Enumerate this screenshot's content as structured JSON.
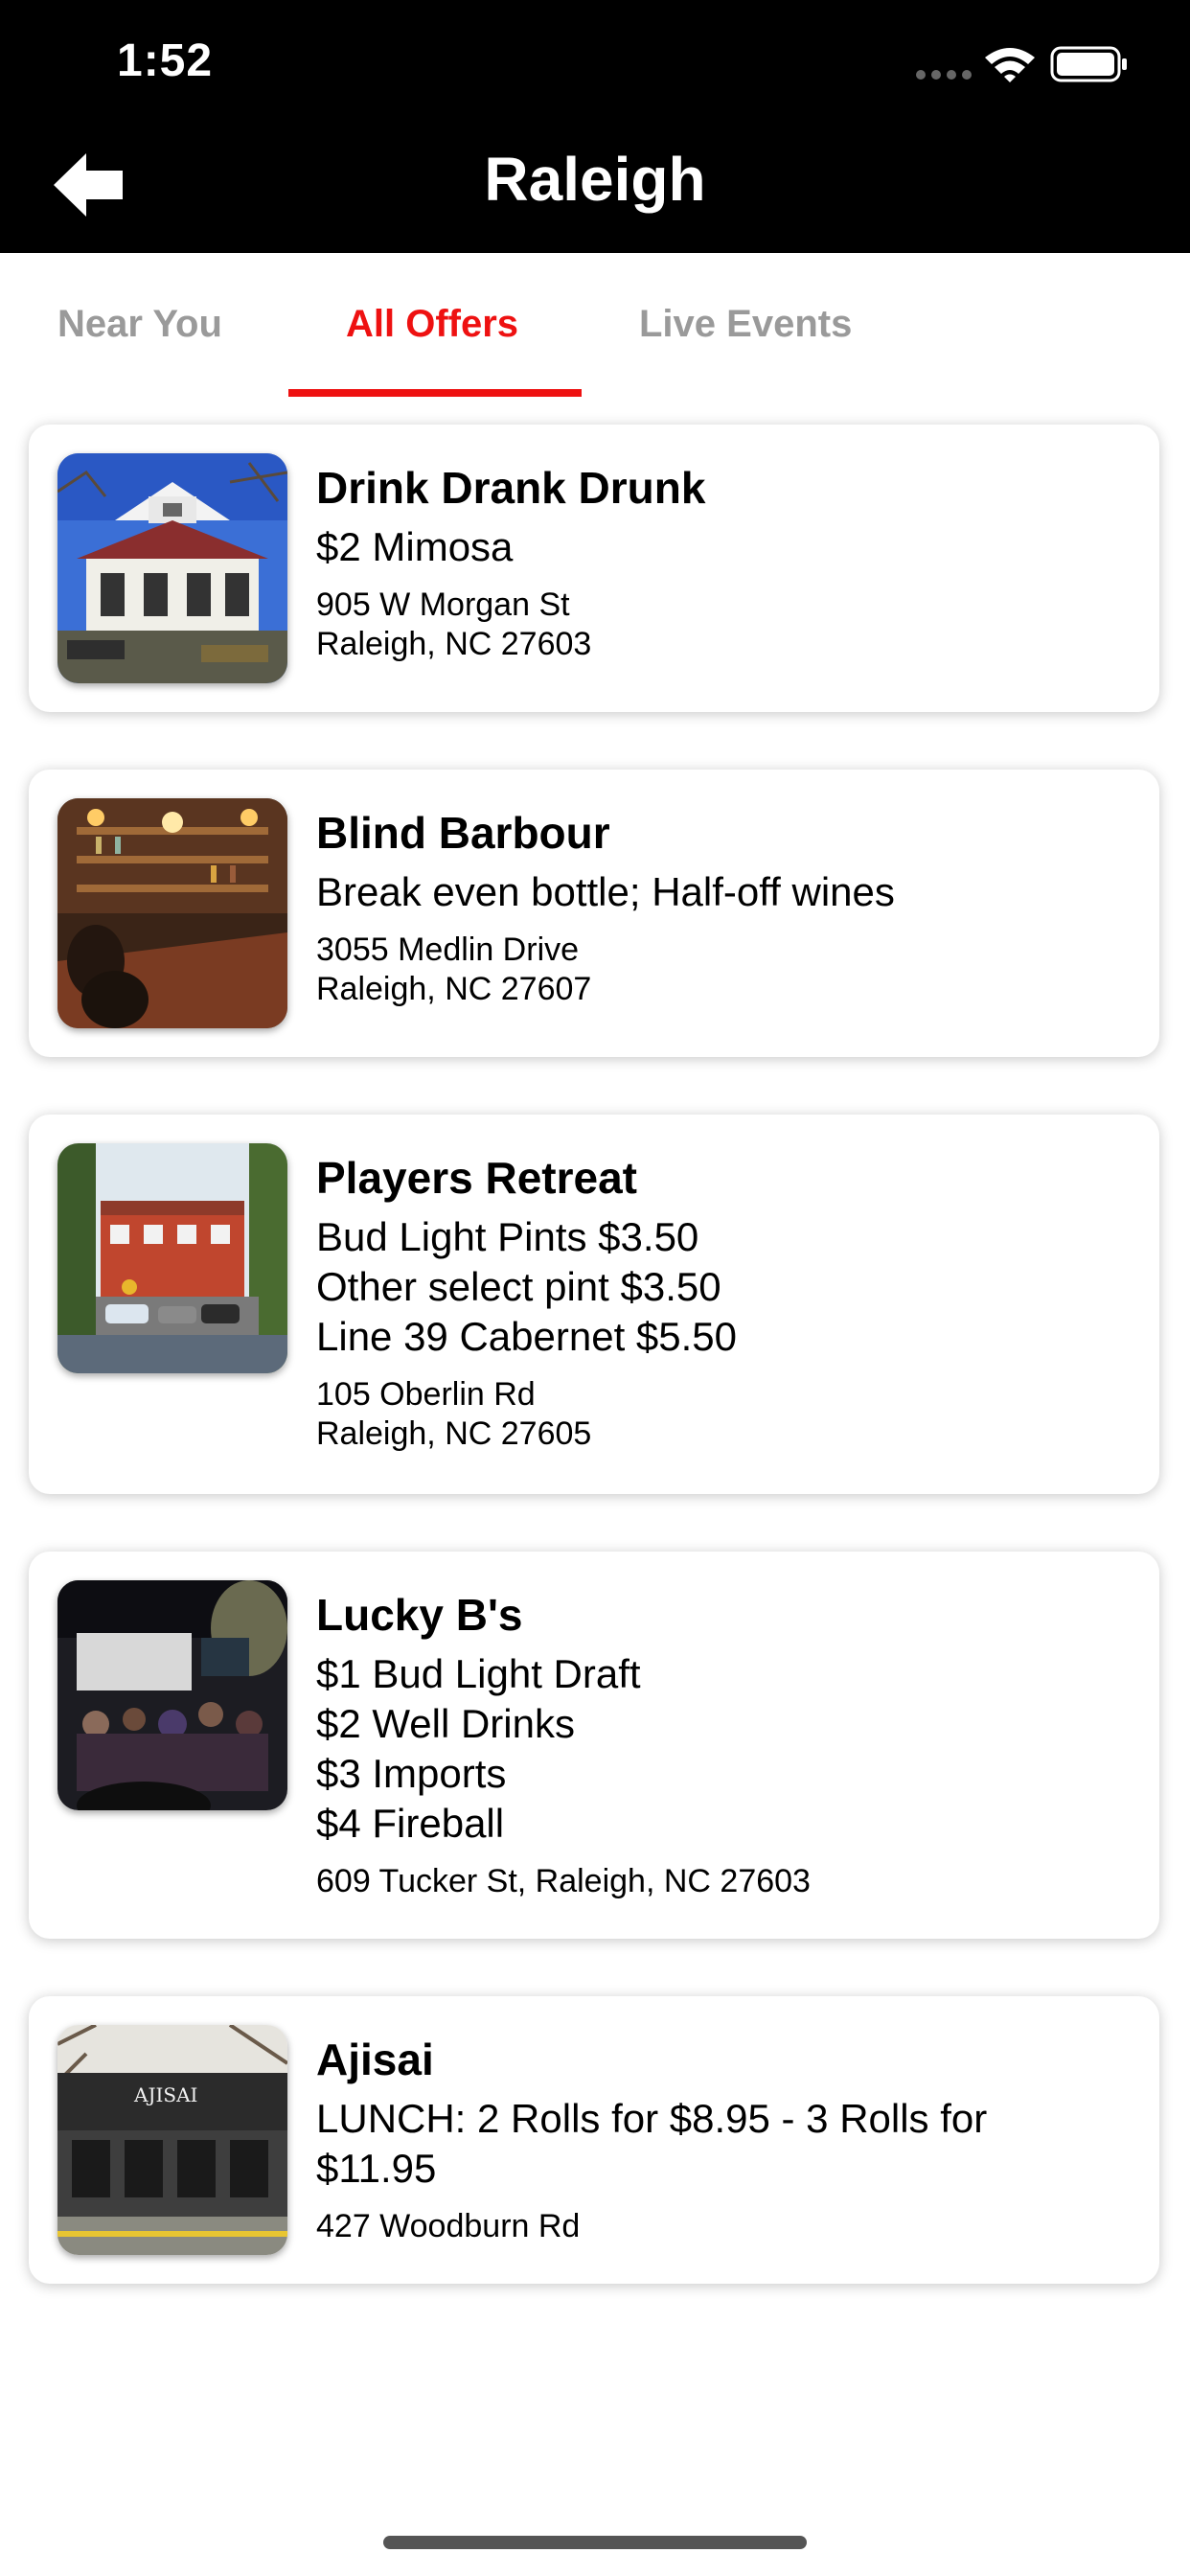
{
  "status_bar": {
    "time": "1:52"
  },
  "header": {
    "title": "Raleigh",
    "back_icon": "back-arrow-icon"
  },
  "tabs": [
    {
      "label": "Near You",
      "active": false
    },
    {
      "label": "All Offers",
      "active": true
    },
    {
      "label": "Live Events",
      "active": false
    }
  ],
  "colors": {
    "accent": "#ee1111",
    "header_bg": "#000000",
    "tab_inactive": "#9a9a9a"
  },
  "venues": [
    {
      "name": "Drink Drank Drunk",
      "offers": [
        "$2 Mimosa"
      ],
      "address": [
        "905 W Morgan St",
        "Raleigh, NC 27603"
      ]
    },
    {
      "name": "Blind Barbour",
      "offers": [
        "Break even bottle; Half-off wines"
      ],
      "address": [
        "3055 Medlin Drive",
        "Raleigh, NC 27607"
      ]
    },
    {
      "name": "Players Retreat",
      "offers": [
        "Bud Light Pints $3.50",
        "Other select pint $3.50",
        "Line 39 Cabernet $5.50"
      ],
      "address": [
        "105 Oberlin Rd",
        "Raleigh, NC 27605"
      ]
    },
    {
      "name": "Lucky B's",
      "offers": [
        "$1 Bud Light Draft",
        "$2 Well Drinks",
        "$3 Imports",
        "$4 Fireball"
      ],
      "address": [
        "609 Tucker St, Raleigh, NC 27603"
      ]
    },
    {
      "name": "Ajisai",
      "offers": [
        "LUNCH: 2 Rolls for $8.95 - 3 Rolls for",
        "$11.95"
      ],
      "address": [
        "427 Woodburn Rd"
      ],
      "thumb_sign": "AJISAI"
    }
  ]
}
